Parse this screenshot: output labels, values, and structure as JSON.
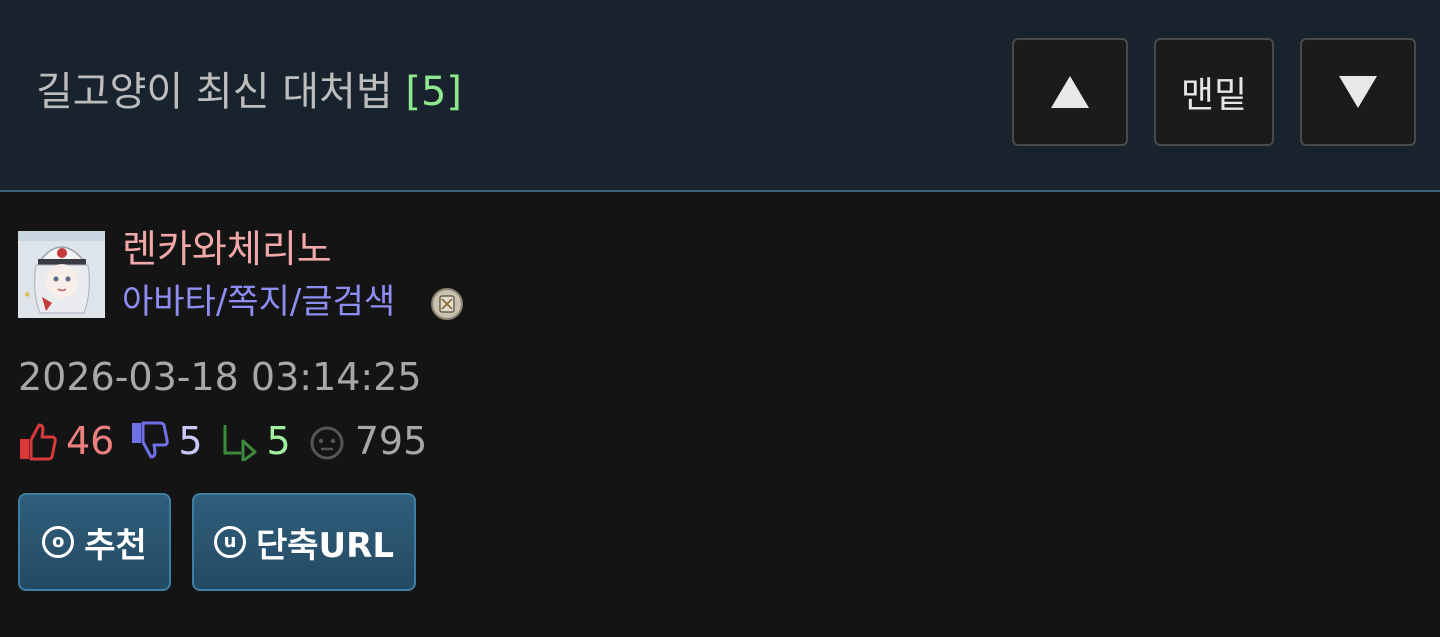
{
  "header": {
    "title": "길고양이 최신 대처법",
    "comment_count": "[5]",
    "bottom_label": "맨밑"
  },
  "author": {
    "name": "렌카와체리노",
    "links": "아바타/쪽지/글검색"
  },
  "post": {
    "datetime": "2026-03-18 03:14:25",
    "upvotes": "46",
    "downvotes": "5",
    "replies": "5",
    "views": "795"
  },
  "actions": {
    "recommend_key": "o",
    "recommend_label": "추천",
    "shorturl_key": "u",
    "shorturl_label": "단축URL"
  },
  "colors": {
    "header_bg": "#19232d",
    "body_bg": "#141414",
    "username": "#f0a8a8",
    "links": "#8e8ef2",
    "upvote": "#ee7f7f",
    "downvote": "#8080f0",
    "reply": "#9ff09f",
    "button": "#2a5573"
  }
}
